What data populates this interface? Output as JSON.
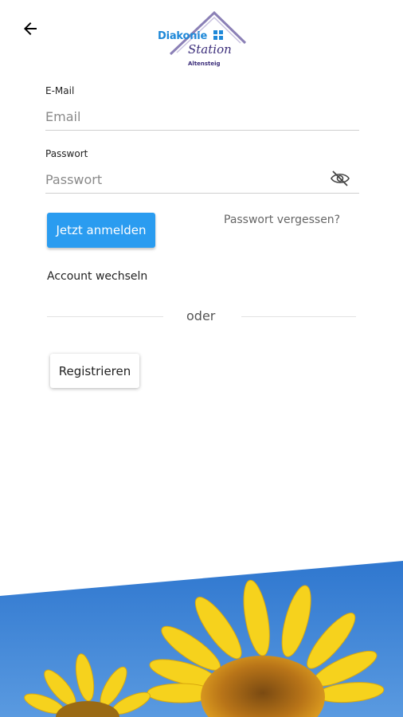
{
  "header": {
    "back_icon": "arrow-left-icon",
    "logo": {
      "title": "Diakonie",
      "script": "Station",
      "subtitle": "Altensteig",
      "brand_blue": "#1e88d8",
      "brand_purple": "#3b2d7a"
    }
  },
  "form": {
    "email": {
      "label": "E-Mail",
      "placeholder": "Email",
      "value": ""
    },
    "password": {
      "label": "Passwort",
      "placeholder": "Passwort",
      "value": "",
      "toggle_icon": "eye-off-icon"
    }
  },
  "actions": {
    "login_label": "Jetzt anmelden",
    "forgot_label": "Passwort vergessen?",
    "switch_account_label": "Account wechseln",
    "divider_label": "oder",
    "register_label": "Registrieren"
  },
  "colors": {
    "accent": "#2a9cf0",
    "sky": "#3f86d8",
    "sunflower": "#f6d21d"
  },
  "hero_image": "sunflower-photo"
}
